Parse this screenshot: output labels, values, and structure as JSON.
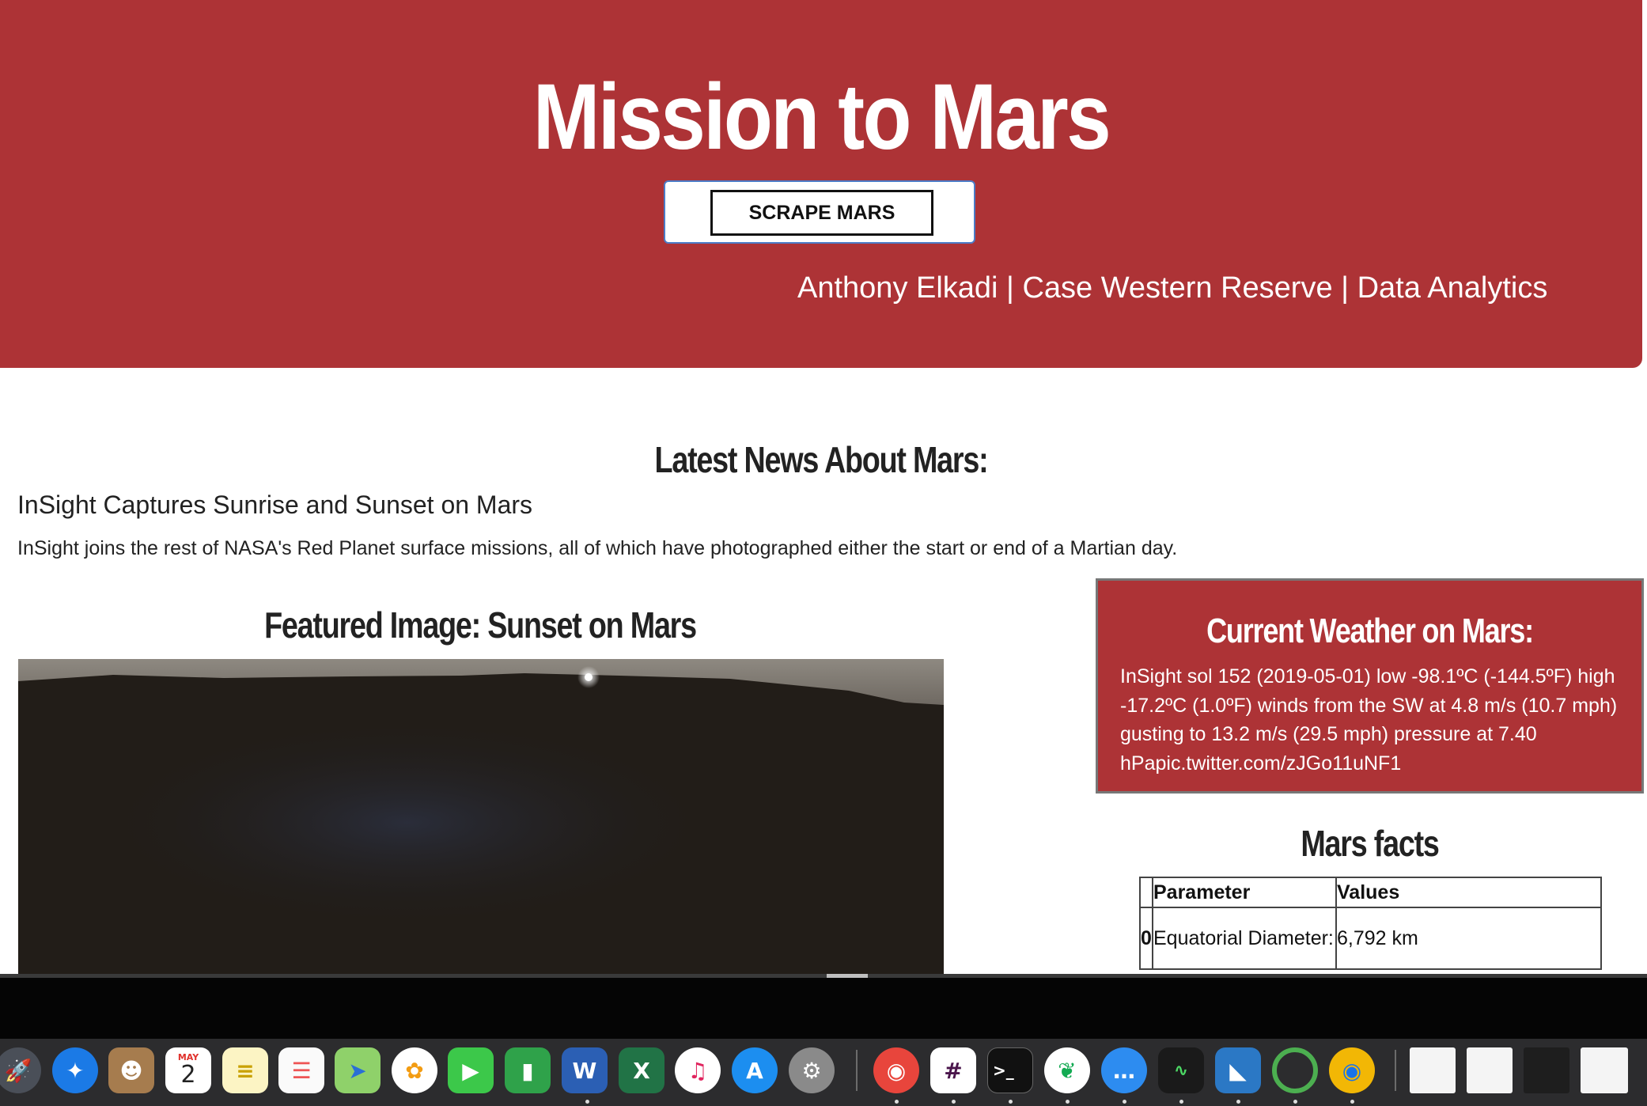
{
  "header": {
    "title": "Mission to Mars",
    "scrape_button": "SCRAPE MARS",
    "credits": "Anthony Elkadi | Case Western Reserve | Data Analytics"
  },
  "news": {
    "heading": "Latest News About Mars:",
    "title": "InSight Captures Sunrise and Sunset on Mars",
    "teaser": "InSight joins the rest of NASA's Red Planet surface missions, all of which have photographed either the start or end of a Martian day."
  },
  "featured": {
    "heading": "Featured Image: Sunset on Mars"
  },
  "weather": {
    "heading": "Current Weather on Mars:",
    "text": "InSight sol 152 (2019-05-01) low -98.1ºC (-144.5ºF) high -17.2ºC (1.0ºF) winds from the SW at 4.8 m/s (10.7 mph) gusting to 13.2 m/s (29.5 mph) pressure at 7.40 hPapic.twitter.com/zJGo11uNF1"
  },
  "facts": {
    "heading": "Mars facts",
    "columns": [
      "Parameter",
      "Values"
    ],
    "rows": [
      {
        "index": "0",
        "parameter": "Equatorial Diameter:",
        "value": "6,792 km"
      }
    ]
  },
  "colors": {
    "mars_red": "#ad3336",
    "text_dark": "#222222"
  },
  "dock": {
    "calendar_month": "MAY",
    "calendar_day": "2",
    "icons": [
      "launchpad-icon",
      "safari-icon",
      "contacts-icon",
      "calendar-icon",
      "notes-icon",
      "reminders-icon",
      "maps-icon",
      "photos-icon",
      "facetime-icon",
      "numbers-icon",
      "word-icon",
      "excel-icon",
      "itunes-icon",
      "app-store-icon",
      "system-preferences-icon",
      "chrome-icon",
      "slack-icon",
      "terminal-icon",
      "mongodb-icon",
      "messages-icon",
      "activity-monitor-icon",
      "vscode-icon",
      "sync-icon",
      "chrome-canary-icon",
      "window-thumbnail-icon",
      "window-thumbnail-icon",
      "window-thumbnail-icon",
      "window-thumbnail-icon"
    ]
  }
}
